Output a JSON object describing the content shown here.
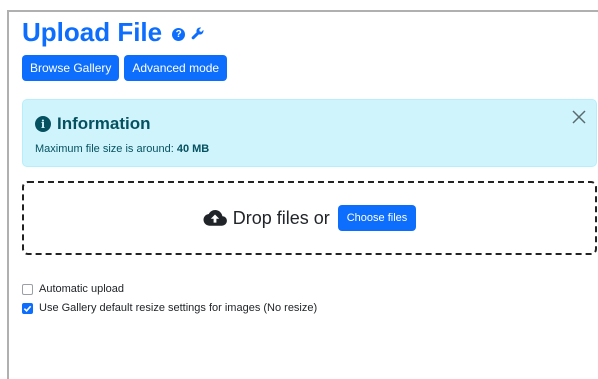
{
  "header": {
    "title": "Upload File",
    "help_icon": "question-circle-icon",
    "help_glyph": "?",
    "settings_icon": "wrench-icon"
  },
  "buttons": {
    "browse_gallery": "Browse Gallery",
    "advanced_mode": "Advanced mode"
  },
  "alert": {
    "icon": "info-circle-icon",
    "icon_glyph": "i",
    "title": "Information",
    "text_prefix": "Maximum file size is around:",
    "max_size": "40 MB",
    "close_icon": "close-icon"
  },
  "dropzone": {
    "icon": "cloud-upload-icon",
    "text": "Drop files or",
    "choose_button": "Choose files"
  },
  "options": {
    "automatic_upload": {
      "label": "Automatic upload",
      "checked": false
    },
    "gallery_resize": {
      "label": "Use Gallery default resize settings for images (No resize)",
      "checked": true
    }
  },
  "colors": {
    "primary": "#0d6efd",
    "info_bg": "#cff4fc",
    "info_text": "#055160"
  }
}
